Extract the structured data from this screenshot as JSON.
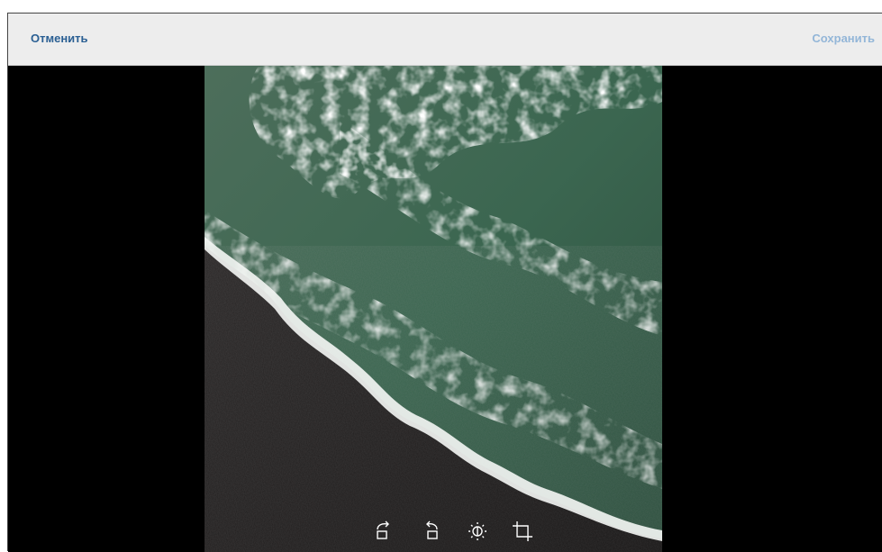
{
  "header": {
    "cancel_label": "Отменить",
    "save_label": "Сохранить"
  },
  "toolbar": {
    "tools": [
      "rotate-right-icon",
      "rotate-left-icon",
      "brightness-icon",
      "crop-icon"
    ]
  },
  "colors": {
    "header_bg": "#ededed",
    "cancel": "#2a5f93",
    "save_disabled": "#93b6d8",
    "stage_bg": "#000000"
  }
}
